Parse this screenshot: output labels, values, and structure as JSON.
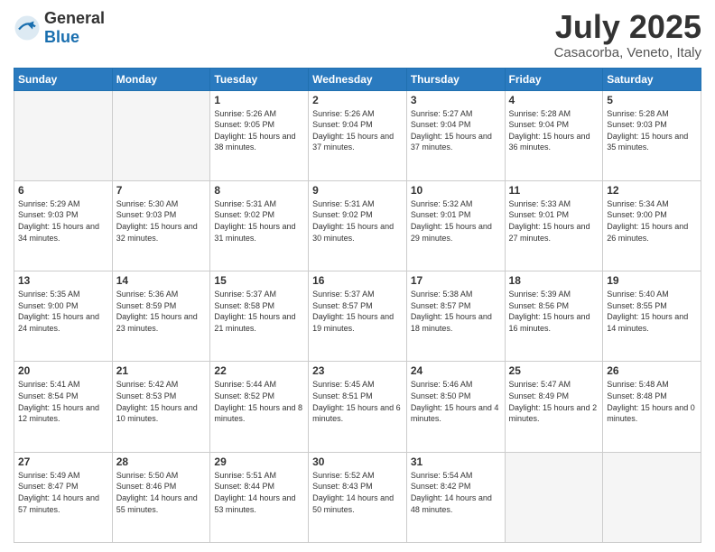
{
  "logo": {
    "general": "General",
    "blue": "Blue"
  },
  "header": {
    "month": "July 2025",
    "location": "Casacorba, Veneto, Italy"
  },
  "weekdays": [
    "Sunday",
    "Monday",
    "Tuesday",
    "Wednesday",
    "Thursday",
    "Friday",
    "Saturday"
  ],
  "weeks": [
    [
      {
        "day": "",
        "sunrise": "",
        "sunset": "",
        "daylight": "",
        "empty": true
      },
      {
        "day": "",
        "sunrise": "",
        "sunset": "",
        "daylight": "",
        "empty": true
      },
      {
        "day": "1",
        "sunrise": "Sunrise: 5:26 AM",
        "sunset": "Sunset: 9:05 PM",
        "daylight": "Daylight: 15 hours and 38 minutes.",
        "empty": false
      },
      {
        "day": "2",
        "sunrise": "Sunrise: 5:26 AM",
        "sunset": "Sunset: 9:04 PM",
        "daylight": "Daylight: 15 hours and 37 minutes.",
        "empty": false
      },
      {
        "day": "3",
        "sunrise": "Sunrise: 5:27 AM",
        "sunset": "Sunset: 9:04 PM",
        "daylight": "Daylight: 15 hours and 37 minutes.",
        "empty": false
      },
      {
        "day": "4",
        "sunrise": "Sunrise: 5:28 AM",
        "sunset": "Sunset: 9:04 PM",
        "daylight": "Daylight: 15 hours and 36 minutes.",
        "empty": false
      },
      {
        "day": "5",
        "sunrise": "Sunrise: 5:28 AM",
        "sunset": "Sunset: 9:03 PM",
        "daylight": "Daylight: 15 hours and 35 minutes.",
        "empty": false
      }
    ],
    [
      {
        "day": "6",
        "sunrise": "Sunrise: 5:29 AM",
        "sunset": "Sunset: 9:03 PM",
        "daylight": "Daylight: 15 hours and 34 minutes.",
        "empty": false
      },
      {
        "day": "7",
        "sunrise": "Sunrise: 5:30 AM",
        "sunset": "Sunset: 9:03 PM",
        "daylight": "Daylight: 15 hours and 32 minutes.",
        "empty": false
      },
      {
        "day": "8",
        "sunrise": "Sunrise: 5:31 AM",
        "sunset": "Sunset: 9:02 PM",
        "daylight": "Daylight: 15 hours and 31 minutes.",
        "empty": false
      },
      {
        "day": "9",
        "sunrise": "Sunrise: 5:31 AM",
        "sunset": "Sunset: 9:02 PM",
        "daylight": "Daylight: 15 hours and 30 minutes.",
        "empty": false
      },
      {
        "day": "10",
        "sunrise": "Sunrise: 5:32 AM",
        "sunset": "Sunset: 9:01 PM",
        "daylight": "Daylight: 15 hours and 29 minutes.",
        "empty": false
      },
      {
        "day": "11",
        "sunrise": "Sunrise: 5:33 AM",
        "sunset": "Sunset: 9:01 PM",
        "daylight": "Daylight: 15 hours and 27 minutes.",
        "empty": false
      },
      {
        "day": "12",
        "sunrise": "Sunrise: 5:34 AM",
        "sunset": "Sunset: 9:00 PM",
        "daylight": "Daylight: 15 hours and 26 minutes.",
        "empty": false
      }
    ],
    [
      {
        "day": "13",
        "sunrise": "Sunrise: 5:35 AM",
        "sunset": "Sunset: 9:00 PM",
        "daylight": "Daylight: 15 hours and 24 minutes.",
        "empty": false
      },
      {
        "day": "14",
        "sunrise": "Sunrise: 5:36 AM",
        "sunset": "Sunset: 8:59 PM",
        "daylight": "Daylight: 15 hours and 23 minutes.",
        "empty": false
      },
      {
        "day": "15",
        "sunrise": "Sunrise: 5:37 AM",
        "sunset": "Sunset: 8:58 PM",
        "daylight": "Daylight: 15 hours and 21 minutes.",
        "empty": false
      },
      {
        "day": "16",
        "sunrise": "Sunrise: 5:37 AM",
        "sunset": "Sunset: 8:57 PM",
        "daylight": "Daylight: 15 hours and 19 minutes.",
        "empty": false
      },
      {
        "day": "17",
        "sunrise": "Sunrise: 5:38 AM",
        "sunset": "Sunset: 8:57 PM",
        "daylight": "Daylight: 15 hours and 18 minutes.",
        "empty": false
      },
      {
        "day": "18",
        "sunrise": "Sunrise: 5:39 AM",
        "sunset": "Sunset: 8:56 PM",
        "daylight": "Daylight: 15 hours and 16 minutes.",
        "empty": false
      },
      {
        "day": "19",
        "sunrise": "Sunrise: 5:40 AM",
        "sunset": "Sunset: 8:55 PM",
        "daylight": "Daylight: 15 hours and 14 minutes.",
        "empty": false
      }
    ],
    [
      {
        "day": "20",
        "sunrise": "Sunrise: 5:41 AM",
        "sunset": "Sunset: 8:54 PM",
        "daylight": "Daylight: 15 hours and 12 minutes.",
        "empty": false
      },
      {
        "day": "21",
        "sunrise": "Sunrise: 5:42 AM",
        "sunset": "Sunset: 8:53 PM",
        "daylight": "Daylight: 15 hours and 10 minutes.",
        "empty": false
      },
      {
        "day": "22",
        "sunrise": "Sunrise: 5:44 AM",
        "sunset": "Sunset: 8:52 PM",
        "daylight": "Daylight: 15 hours and 8 minutes.",
        "empty": false
      },
      {
        "day": "23",
        "sunrise": "Sunrise: 5:45 AM",
        "sunset": "Sunset: 8:51 PM",
        "daylight": "Daylight: 15 hours and 6 minutes.",
        "empty": false
      },
      {
        "day": "24",
        "sunrise": "Sunrise: 5:46 AM",
        "sunset": "Sunset: 8:50 PM",
        "daylight": "Daylight: 15 hours and 4 minutes.",
        "empty": false
      },
      {
        "day": "25",
        "sunrise": "Sunrise: 5:47 AM",
        "sunset": "Sunset: 8:49 PM",
        "daylight": "Daylight: 15 hours and 2 minutes.",
        "empty": false
      },
      {
        "day": "26",
        "sunrise": "Sunrise: 5:48 AM",
        "sunset": "Sunset: 8:48 PM",
        "daylight": "Daylight: 15 hours and 0 minutes.",
        "empty": false
      }
    ],
    [
      {
        "day": "27",
        "sunrise": "Sunrise: 5:49 AM",
        "sunset": "Sunset: 8:47 PM",
        "daylight": "Daylight: 14 hours and 57 minutes.",
        "empty": false
      },
      {
        "day": "28",
        "sunrise": "Sunrise: 5:50 AM",
        "sunset": "Sunset: 8:46 PM",
        "daylight": "Daylight: 14 hours and 55 minutes.",
        "empty": false
      },
      {
        "day": "29",
        "sunrise": "Sunrise: 5:51 AM",
        "sunset": "Sunset: 8:44 PM",
        "daylight": "Daylight: 14 hours and 53 minutes.",
        "empty": false
      },
      {
        "day": "30",
        "sunrise": "Sunrise: 5:52 AM",
        "sunset": "Sunset: 8:43 PM",
        "daylight": "Daylight: 14 hours and 50 minutes.",
        "empty": false
      },
      {
        "day": "31",
        "sunrise": "Sunrise: 5:54 AM",
        "sunset": "Sunset: 8:42 PM",
        "daylight": "Daylight: 14 hours and 48 minutes.",
        "empty": false
      },
      {
        "day": "",
        "sunrise": "",
        "sunset": "",
        "daylight": "",
        "empty": true
      },
      {
        "day": "",
        "sunrise": "",
        "sunset": "",
        "daylight": "",
        "empty": true
      }
    ]
  ]
}
